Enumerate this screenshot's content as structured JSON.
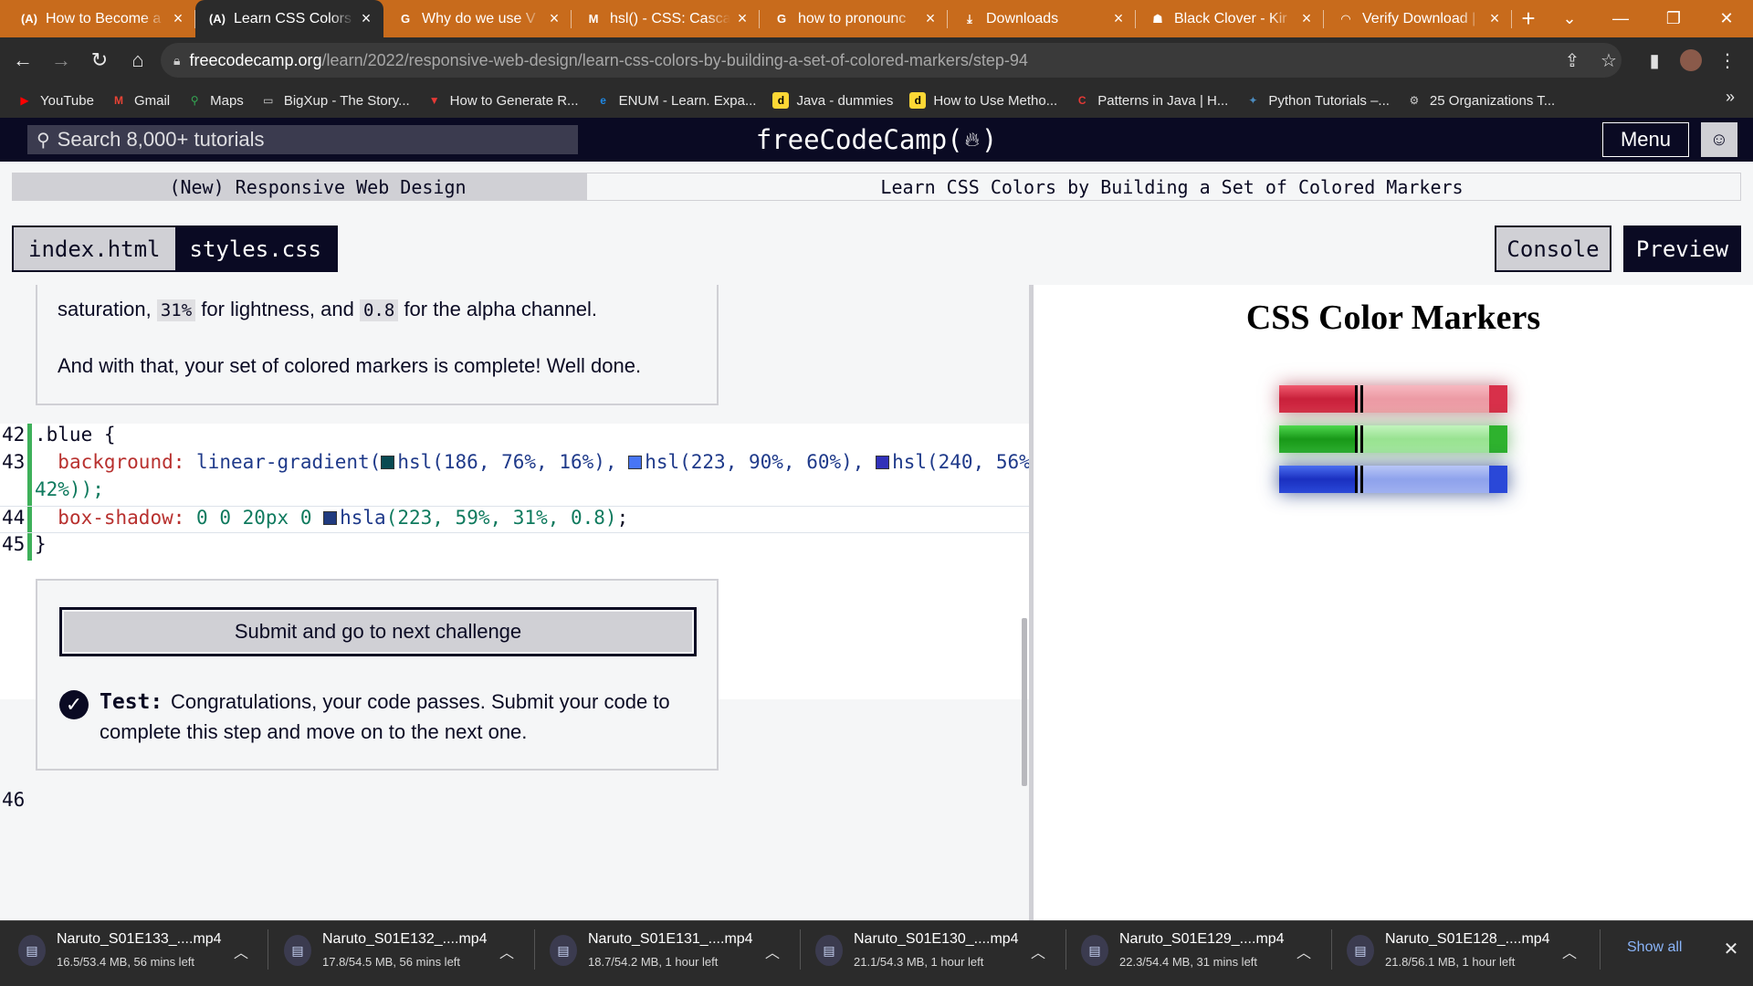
{
  "browser": {
    "tabs": [
      {
        "title": "How to Become a",
        "favicon": "(A)"
      },
      {
        "title": "Learn CSS Colors",
        "favicon": "(A)",
        "active": true
      },
      {
        "title": "Why do we use V",
        "favicon": "G"
      },
      {
        "title": "hsl() - CSS: Casca",
        "favicon": "M"
      },
      {
        "title": "how to pronounc",
        "favicon": "G"
      },
      {
        "title": "Downloads",
        "favicon": "⤓"
      },
      {
        "title": "Black Clover - Kir",
        "favicon": "☗"
      },
      {
        "title": "Verify Download |",
        "favicon": "◠"
      }
    ],
    "url_host": "freecodecamp.org",
    "url_path": "/learn/2022/responsive-web-design/learn-css-colors-by-building-a-set-of-colored-markers/step-94",
    "bookmarks": [
      {
        "label": "YouTube",
        "color": "#ff0000",
        "glyph": "▶"
      },
      {
        "label": "Gmail",
        "color": "#ea4335",
        "glyph": "M"
      },
      {
        "label": "Maps",
        "color": "#34a853",
        "glyph": "⚲"
      },
      {
        "label": "BigXup - The Story...",
        "color": "#9e9e9e",
        "glyph": "▭"
      },
      {
        "label": "How to Generate R...",
        "color": "#e53935",
        "glyph": "▼"
      },
      {
        "label": "ENUM - Learn. Expa...",
        "color": "#1e88e5",
        "glyph": "e"
      },
      {
        "label": "Java - dummies",
        "color": "#fdd835",
        "glyph": "d"
      },
      {
        "label": "How to Use Metho...",
        "color": "#fdd835",
        "glyph": "d"
      },
      {
        "label": "Patterns in Java | H...",
        "color": "#e53935",
        "glyph": "C"
      },
      {
        "label": "Python Tutorials –...",
        "color": "#4b8bbe",
        "glyph": "✦"
      },
      {
        "label": "25 Organizations T...",
        "color": "#9e9e9e",
        "glyph": "⚙"
      }
    ],
    "bookmarks_more": "»"
  },
  "fcc": {
    "search_placeholder": "Search 8,000+ tutorials",
    "logo_text": "freeCodeCamp(",
    "logo_end": ")",
    "menu_label": "Menu",
    "breadcrumb_course": "(New) Responsive Web Design",
    "breadcrumb_project": "Learn CSS Colors by Building a Set of Colored Markers",
    "file_tabs": {
      "html": "index.html",
      "css": "styles.css"
    },
    "console_label": "Console",
    "preview_label": "Preview"
  },
  "description": {
    "line1_a": "saturation,",
    "line1_code1": "31%",
    "line1_b": "for lightness, and",
    "line1_code2": "0.8",
    "line1_c": "for the alpha channel.",
    "line2": "And with that, your set of colored markers is complete! Well done."
  },
  "code": {
    "line42": {
      "num": "42",
      "text": ".blue {"
    },
    "line43": {
      "num": "43",
      "prop": "background:",
      "fn": "linear-gradient(",
      "c1": "hsl(186, 76%, 16%),",
      "c1_color": "#0a4a52",
      "c2": "hsl(223, 90%, 60%),",
      "c2_color": "#4775f5",
      "c3": "hsl(240, 56%",
      "c3_color": "#3131b9",
      "wrap": "42%));"
    },
    "line44": {
      "num": "44",
      "prop": "box-shadow:",
      "vals": "0 0 20px 0",
      "fn": "hsla",
      "args": "(223, 59%, 31%, 0.8)",
      "end": ";",
      "swatch_color": "#213b7f"
    },
    "line45": {
      "num": "45",
      "text": "}"
    },
    "line46": {
      "num": "46"
    }
  },
  "submit": {
    "button_label": "Submit and go to next challenge",
    "test_label": "Test:",
    "test_text_1": "Congratulations, your code passes. Submit your code to",
    "test_text_2": "complete this step and move on to the next one."
  },
  "preview": {
    "title": "CSS Color Markers",
    "markers": [
      {
        "name": "red",
        "cap": "#d8304a",
        "sleeve": "#efa2aa",
        "shadow": "rgba(160,40,60,0.6)"
      },
      {
        "name": "green",
        "cap": "#2eb22e",
        "sleeve": "#a6eaa0",
        "shadow": "rgba(40,140,40,0.6)"
      },
      {
        "name": "blue",
        "cap": "#2a48d8",
        "sleeve": "#9fb0f0",
        "shadow": "rgba(33,59,127,0.8)"
      }
    ]
  },
  "downloads": {
    "items": [
      {
        "name": "Naruto_S01E133_....mp4",
        "status": "16.5/53.4 MB, 56 mins left"
      },
      {
        "name": "Naruto_S01E132_....mp4",
        "status": "17.8/54.5 MB, 56 mins left"
      },
      {
        "name": "Naruto_S01E131_....mp4",
        "status": "18.7/54.2 MB, 1 hour left"
      },
      {
        "name": "Naruto_S01E130_....mp4",
        "status": "21.1/54.3 MB, 1 hour left"
      },
      {
        "name": "Naruto_S01E129_....mp4",
        "status": "22.3/54.4 MB, 31 mins left"
      },
      {
        "name": "Naruto_S01E128_....mp4",
        "status": "21.8/56.1 MB, 1 hour left"
      }
    ],
    "show_all": "Show all"
  }
}
